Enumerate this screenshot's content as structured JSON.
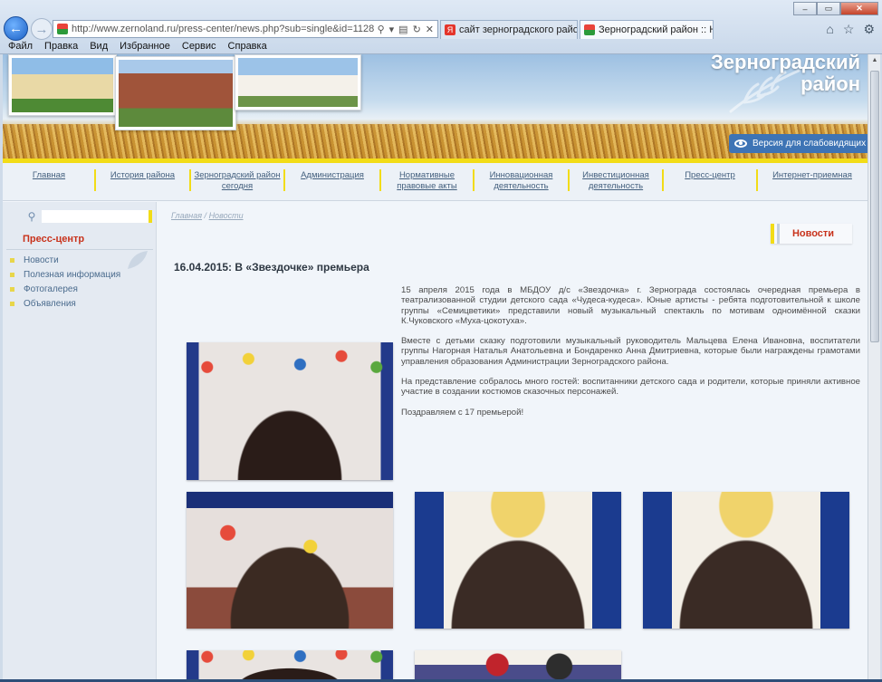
{
  "browser": {
    "url": "http://www.zernoland.ru/press-center/news.php?sub=single&id=1128",
    "tabs": [
      {
        "label": "сайт зерноградского района ..."
      },
      {
        "label": "Зерноградский район :: Н..."
      }
    ],
    "menu": [
      "Файл",
      "Правка",
      "Вид",
      "Избранное",
      "Сервис",
      "Справка"
    ],
    "window_controls": [
      "–",
      "▭",
      "✕"
    ]
  },
  "site": {
    "title_line1": "Зерноградский",
    "title_line2": "район",
    "blind_version": "Версия для слабовидящих"
  },
  "nav": [
    {
      "label": "Главная"
    },
    {
      "label": "История района"
    },
    {
      "label": "Зерноградский район сегодня"
    },
    {
      "label": "Администрация"
    },
    {
      "label": "Нормативные правовые акты"
    },
    {
      "label": "Инновационная деятельность"
    },
    {
      "label": "Инвестиционная деятельность"
    },
    {
      "label": "Пресс-центр"
    },
    {
      "label": "Интернет-приемная"
    }
  ],
  "sidebar": {
    "search_value": "",
    "heading": "Пресс-центр",
    "items": [
      {
        "label": "Новости"
      },
      {
        "label": "Полезная информация"
      },
      {
        "label": "Фотогалерея"
      },
      {
        "label": "Объявления"
      }
    ]
  },
  "content": {
    "breadcrumb": {
      "home": "Главная",
      "sep": " / ",
      "current": "Новости"
    },
    "section": "Новости",
    "title": "16.04.2015: В «Звездочке» премьера",
    "paragraphs": [
      "15 апреля 2015 года в МБДОУ д/с «Звездочка» г. Зернограда состоялась очередная премьера в театрализованной студии детского сада «Чудеса-кудеса». Юные артисты - ребята подготовительной к школе группы «Семицветики» представили новый музыкальный спектакль по мотивам одноимённой сказки К.Чуковского «Муха-цокотуха».",
      "Вместе с детьми сказку подготовили музыкальный руководитель Мальцева Елена Ивановна, воспитатели группы Нагорная Наталья Анатольевна и Бондаренко Анна Дмитриевна, которые были награждены грамотами управления образования Администрации Зерноградского района.",
      "На представление собралось много гостей: воспитанники детского сада и родители, которые приняли активное участие в создании костюмов сказочных персонажей.",
      "Поздравляем с 17 премьерой!"
    ]
  }
}
